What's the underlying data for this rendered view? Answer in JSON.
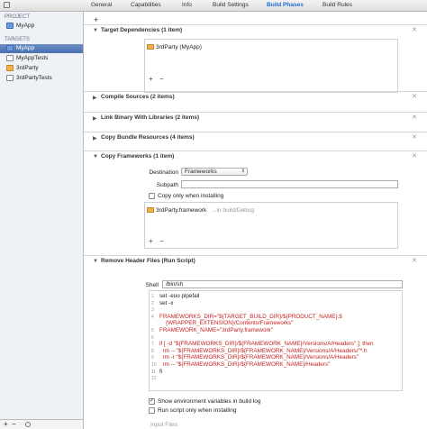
{
  "tabs": [
    "General",
    "Capabilities",
    "Info",
    "Build Settings",
    "Build Phases",
    "Build Rules"
  ],
  "active_tab": "Build Phases",
  "sidebar": {
    "project_header": "PROJECT",
    "project_item": "MyApp",
    "targets_header": "TARGETS",
    "targets": [
      {
        "label": "MyApp",
        "selected": true,
        "icon": "app-icon"
      },
      {
        "label": "MyAppTests",
        "selected": false,
        "icon": "test-bundle-icon"
      },
      {
        "label": "3rdParty",
        "selected": false,
        "icon": "framework-icon"
      },
      {
        "label": "3rdPartyTests",
        "selected": false,
        "icon": "test-bundle-icon"
      }
    ]
  },
  "phases": {
    "target_dependencies": {
      "title": "Target Dependencies (1 item)",
      "item": "3rdParty (MyApp)"
    },
    "compile_sources": {
      "title": "Compile Sources (2 items)"
    },
    "link_binary": {
      "title": "Link Binary With Libraries (2 items)"
    },
    "copy_bundle": {
      "title": "Copy Bundle Resources (4 items)"
    },
    "copy_frameworks": {
      "title": "Copy Frameworks (1 item)",
      "destination_label": "Destination",
      "destination_value": "Frameworks",
      "subpath_label": "Subpath",
      "subpath_value": "",
      "copy_only_label": "Copy only when installing",
      "item_name": "3rdParty.framework",
      "item_path": "...in build/Debug"
    },
    "remove_headers": {
      "title": "Remove Header Files (Run Script)",
      "shell_label": "Shell",
      "shell_value": "/bin/sh",
      "show_env_label": "Show environment variables in build log",
      "run_only_label": "Run script only when installing",
      "input_files_label": "Input Files"
    }
  },
  "script_lines": [
    {
      "n": "1",
      "text": "set -euo pipefail"
    },
    {
      "n": "2",
      "text": "set -x"
    },
    {
      "n": "3",
      "text": ""
    },
    {
      "n": "4",
      "text": "FRAMEWORKS_DIR=\"${TARGET_BUILD_DIR}/${PRODUCT_NAME}.$"
    },
    {
      "n": "",
      "text": "    {WRAPPER_EXTENSION}/Contents/Frameworks\""
    },
    {
      "n": "5",
      "text": "FRAMEWORK_NAME=\"3rdParty.framework\""
    },
    {
      "n": "6",
      "text": ""
    },
    {
      "n": "7",
      "text": "if [ -d \"${FRAMEWORKS_DIR}/${FRAMEWORK_NAME}/Versions/A/Headers\" ]; then"
    },
    {
      "n": "8",
      "text": "  rm -- \"${FRAMEWORKS_DIR}/${FRAMEWORK_NAME}/Versions/A/Headers/\"*.h"
    },
    {
      "n": "9",
      "text": "  rm -r \"${FRAMEWORKS_DIR}/${FRAMEWORK_NAME}/Versions/A/Headers\""
    },
    {
      "n": "10",
      "text": "  rm -- \"${FRAMEWORKS_DIR}/${FRAMEWORK_NAME}/Headers\""
    },
    {
      "n": "11",
      "text": "fi"
    },
    {
      "n": "12",
      "text": ""
    }
  ],
  "buttons": {
    "add": "+",
    "remove": "−"
  }
}
